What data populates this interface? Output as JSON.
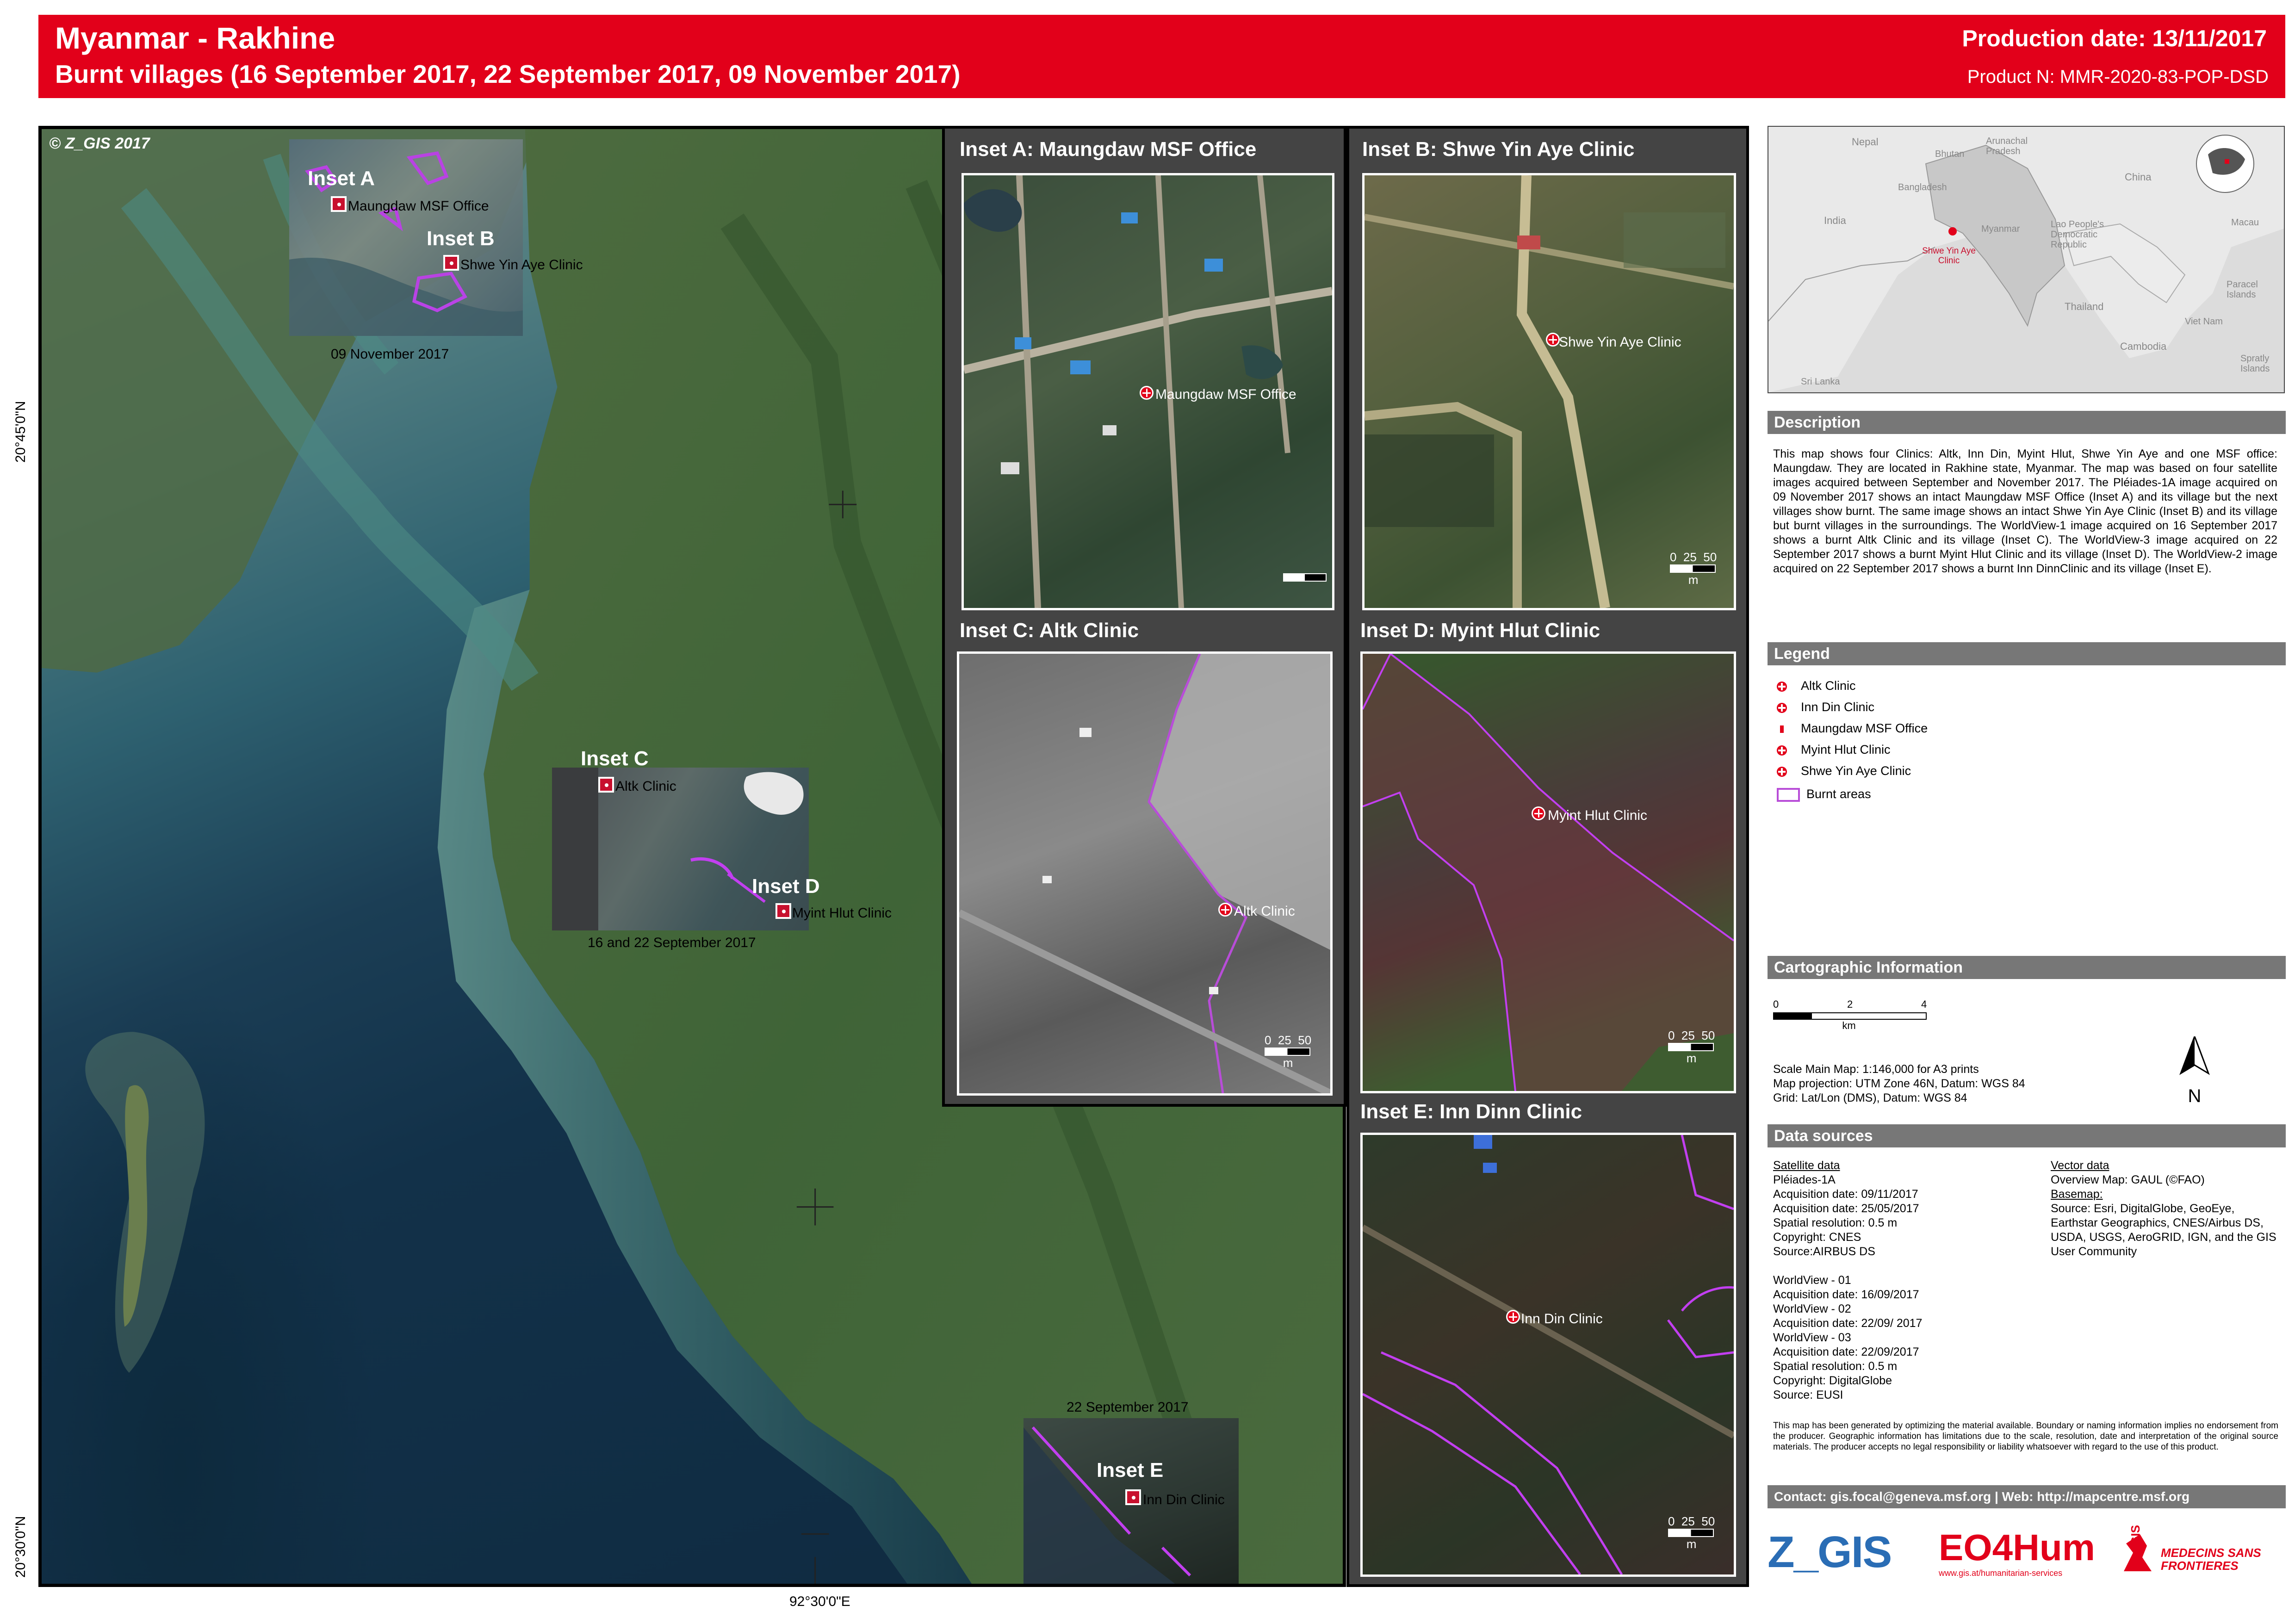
{
  "header": {
    "title": "Myanmar - Rakhine",
    "subtitle": "Burnt villages (16 September 2017, 22 September 2017, 09 November 2017)",
    "production_date": "Production date: 13/11/2017",
    "product_number": "Product N:  MMR-2020-83-POP-DSD"
  },
  "main_map": {
    "copyright": "© Z_GIS 2017",
    "lat_top": "20°45'0\"N",
    "lat_bottom": "20°30'0\"N",
    "lon": "92°30'0\"E",
    "inset_a_tag": "Inset A",
    "inset_b_tag": "Inset B",
    "inset_c_tag": "Inset C",
    "inset_d_tag": "Inset D",
    "inset_e_tag": "Inset E",
    "label_maungdaw": "Maungdaw MSF Office",
    "label_shwe": "Shwe Yin Aye Clinic",
    "label_altk": "Altk Clinic",
    "label_myint": "Myint Hlut Clinic",
    "label_inn": "Inn Din Clinic",
    "date_ab": "09 November 2017",
    "date_cd": "16 and 22 September 2017",
    "date_e": "22 September 2017"
  },
  "insets": {
    "a": {
      "title": "Inset A: Maungdaw MSF Office",
      "label": "Maungdaw MSF Office"
    },
    "b": {
      "title": "Inset B: Shwe Yin Aye Clinic",
      "label": "Shwe Yin Aye Clinic"
    },
    "c": {
      "title": "Inset C: Altk Clinic",
      "label": "Altk Clinic"
    },
    "d": {
      "title": "Inset D: Myint Hlut Clinic",
      "label": "Myint Hlut Clinic"
    },
    "e": {
      "title": "Inset E: Inn Dinn Clinic",
      "label": "Inn Din Clinic"
    },
    "scale": {
      "zero": "0",
      "mid": "25",
      "max": "50",
      "unit": "m"
    }
  },
  "overview": {
    "labels": {
      "nepal": "Nepal",
      "arunachal": "Arunachal Pradesh",
      "bhutan": "Bhutan",
      "china": "China",
      "bangladesh": "Bangladesh",
      "india": "India",
      "myanmar": "Myanmar",
      "laos": "Lao People's Democratic Republic",
      "macau": "Macau",
      "clinic": "Shwe Yin Aye Clinic",
      "thailand": "Thailand",
      "paracel": "Paracel Islands",
      "vietnam": "Viet Nam",
      "cambodia": "Cambodia",
      "spratly": "Spratly Islands",
      "srilanka": "Sri Lanka"
    }
  },
  "description": {
    "heading": "Description",
    "text": "This map shows four Clinics: Altk, Inn Din, Myint Hlut, Shwe Yin Aye and one MSF office: Maungdaw. They are located in Rakhine state, Myanmar. The map was based on four satellite images acquired between September and November 2017. The Pléiades-1A image acquired on 09 November 2017 shows an intact Maungdaw MSF Office (Inset A) and its village but the next villages show burnt. The same image shows an intact Shwe Yin Aye Clinic (Inset B) and its village but burnt villages in the surroundings. The WorldView-1 image acquired on 16 September 2017 shows a burnt Altk Clinic and its village (Inset C). The WorldView-3 image acquired on 22 September 2017 shows a burnt Myint Hlut Clinic and its village (Inset D). The WorldView-2 image acquired on 22 September 2017 shows a burnt Inn DinnClinic and its village (Inset E)."
  },
  "legend": {
    "heading": "Legend",
    "items": [
      "Altk Clinic",
      "Inn Din Clinic",
      "Maungdaw MSF Office",
      "Myint Hlut Clinic",
      "Shwe Yin Aye Clinic",
      "Burnt areas"
    ]
  },
  "cartographic": {
    "heading": "Cartographic Information",
    "scale_ticks": [
      "0",
      "2",
      "4"
    ],
    "scale_unit": "km",
    "north": "N",
    "lines": [
      "Scale Main Map: 1:146,000 for A3 prints",
      "Map projection: UTM Zone 46N, Datum: WGS 84",
      "Grid: Lat/Lon (DMS), Datum: WGS 84"
    ]
  },
  "data_sources": {
    "heading": "Data sources",
    "sat_heading": "Satellite data",
    "sat_lines": [
      "Pléiades-1A",
      "Acquisition date: 09/11/2017",
      "Acquisition date: 25/05/2017",
      "Spatial resolution: 0.5 m",
      "Copyright: CNES",
      "Source:AIRBUS DS",
      "",
      "WorldView - 01",
      "Acquisition date: 16/09/2017",
      "WorldView - 02",
      "Acquisition date: 22/09/ 2017",
      "WorldView - 03",
      "Acquisition date: 22/09/2017",
      "Spatial resolution: 0.5 m",
      "Copyright: DigitalGlobe",
      "Source: EUSI"
    ],
    "vec_heading": "Vector data",
    "vec_line": "Overview Map: GAUL (©FAO)",
    "basemap_heading": "Basemap:",
    "basemap_text": "Source: Esri, DigitalGlobe, GeoEye, Earthstar Geographics, CNES/Airbus DS, USDA, USGS, AeroGRID, IGN, and the GIS User Community",
    "disclaimer": "This map has been generated by optimizing the material available. Boundary or naming information implies no endorsement from the producer. Geographic information has limitations due to the scale, resolution, date and interpretation of the original source materials. The producer accepts no legal responsibility or liability whatsoever with regard to the use of this product."
  },
  "contact": {
    "text": "Contact: gis.focal@geneva.msf.org | Web: http://mapcentre.msf.org"
  },
  "logos": {
    "zgis": "Z_GIS",
    "eo4hum": "EO4Hum",
    "eo4hum_url": "www.gis.at/humanitarian-services",
    "msf": "MEDECINS SANS FRONTIERES",
    "msf_gis": "GIS"
  },
  "colors": {
    "header_red": "#e2001a",
    "burnt_purple": "#b84dd8",
    "section_grey": "#777777"
  }
}
